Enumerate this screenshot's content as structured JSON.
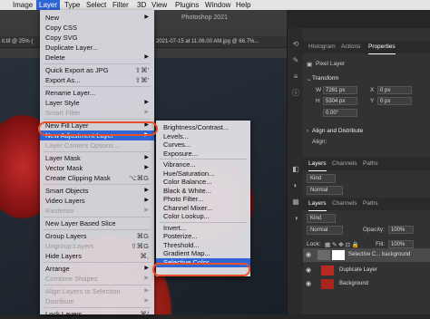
{
  "menubar": {
    "items": [
      "Image",
      "Layer",
      "Type",
      "Select",
      "Filter",
      "3D",
      "View",
      "Plugins",
      "Window",
      "Help"
    ],
    "active": "Layer"
  },
  "app": {
    "title": "Photoshop 2021",
    "doc_tab_left": "it.tif @ 25% (",
    "doc_tab_right": "2021-07-15 at 11.06.00 AM.jpg @ 66.7%..."
  },
  "layer_menu": [
    {
      "label": "New",
      "shortcut": "",
      "arrow": true,
      "disabled": false
    },
    {
      "label": "Copy CSS",
      "shortcut": "",
      "arrow": false,
      "disabled": false
    },
    {
      "label": "Copy SVG",
      "shortcut": "",
      "arrow": false,
      "disabled": false
    },
    {
      "label": "Duplicate Layer...",
      "shortcut": "",
      "arrow": false,
      "disabled": false
    },
    {
      "label": "Delete",
      "shortcut": "",
      "arrow": true,
      "disabled": false
    },
    {
      "sep": true
    },
    {
      "label": "Quick Export as JPG",
      "shortcut": "⇧⌘'",
      "arrow": false,
      "disabled": false
    },
    {
      "label": "Export As...",
      "shortcut": "⇧⌘'",
      "arrow": false,
      "disabled": false
    },
    {
      "sep": true
    },
    {
      "label": "Rename Layer...",
      "shortcut": "",
      "arrow": false,
      "disabled": false
    },
    {
      "label": "Layer Style",
      "shortcut": "",
      "arrow": true,
      "disabled": false
    },
    {
      "label": "Smart Filter",
      "shortcut": "",
      "arrow": true,
      "disabled": true
    },
    {
      "sep": true
    },
    {
      "label": "New Fill Layer",
      "shortcut": "",
      "arrow": true,
      "disabled": false
    },
    {
      "label": "New Adjustment Layer",
      "shortcut": "",
      "arrow": true,
      "disabled": false,
      "highlighted": true
    },
    {
      "label": "Layer Content Options...",
      "shortcut": "",
      "arrow": false,
      "disabled": true
    },
    {
      "sep": true
    },
    {
      "label": "Layer Mask",
      "shortcut": "",
      "arrow": true,
      "disabled": false
    },
    {
      "label": "Vector Mask",
      "shortcut": "",
      "arrow": true,
      "disabled": false
    },
    {
      "label": "Create Clipping Mask",
      "shortcut": "⌥⌘G",
      "arrow": false,
      "disabled": false
    },
    {
      "sep": true
    },
    {
      "label": "Smart Objects",
      "shortcut": "",
      "arrow": true,
      "disabled": false
    },
    {
      "label": "Video Layers",
      "shortcut": "",
      "arrow": true,
      "disabled": false
    },
    {
      "label": "Rasterize",
      "shortcut": "",
      "arrow": true,
      "disabled": true
    },
    {
      "sep": true
    },
    {
      "label": "New Layer Based Slice",
      "shortcut": "",
      "arrow": false,
      "disabled": false
    },
    {
      "sep": true
    },
    {
      "label": "Group Layers",
      "shortcut": "⌘G",
      "arrow": false,
      "disabled": false
    },
    {
      "label": "Ungroup Layers",
      "shortcut": "⇧⌘G",
      "arrow": false,
      "disabled": true
    },
    {
      "label": "Hide Layers",
      "shortcut": "⌘,",
      "arrow": false,
      "disabled": false
    },
    {
      "sep": true
    },
    {
      "label": "Arrange",
      "shortcut": "",
      "arrow": true,
      "disabled": false
    },
    {
      "label": "Combine Shapes",
      "shortcut": "",
      "arrow": true,
      "disabled": true
    },
    {
      "sep": true
    },
    {
      "label": "Align Layers to Selection",
      "shortcut": "",
      "arrow": true,
      "disabled": true
    },
    {
      "label": "Distribute",
      "shortcut": "",
      "arrow": true,
      "disabled": true
    },
    {
      "sep": true
    },
    {
      "label": "Lock Layers...",
      "shortcut": "⌘/",
      "arrow": false,
      "disabled": false
    }
  ],
  "adjustment_submenu": [
    {
      "label": "Brightness/Contrast..."
    },
    {
      "label": "Levels..."
    },
    {
      "label": "Curves..."
    },
    {
      "label": "Exposure..."
    },
    {
      "sep": true
    },
    {
      "label": "Vibrance..."
    },
    {
      "label": "Hue/Saturation..."
    },
    {
      "label": "Color Balance..."
    },
    {
      "label": "Black & White..."
    },
    {
      "label": "Photo Filter..."
    },
    {
      "label": "Channel Mixer..."
    },
    {
      "label": "Color Lookup..."
    },
    {
      "sep": true
    },
    {
      "label": "Invert..."
    },
    {
      "label": "Posterize..."
    },
    {
      "label": "Threshold..."
    },
    {
      "label": "Gradient Map..."
    },
    {
      "label": "Selective Color...",
      "highlighted": true
    }
  ],
  "panel": {
    "top_tabs": [
      "Histogram",
      "Actions",
      "Properties"
    ],
    "active_top_tab": "Properties",
    "pixel_layer": "Pixel Layer",
    "transform": "Transform",
    "w_label": "W",
    "w_value": "7281 px",
    "h_label": "H",
    "h_value": "5304 px",
    "x_label": "X",
    "x_value": "0 px",
    "y_label": "Y",
    "y_value": "0 px",
    "angle_value": "0.00°",
    "align": "Align and Distribute",
    "align_sub": "Align:",
    "layer_tabs_1": [
      "Layers",
      "Channels",
      "Paths"
    ],
    "layer_tabs_2": [
      "Layers",
      "Channels",
      "Paths"
    ],
    "kind": "Kind",
    "blend": "Normal",
    "opacity_label": "Opacity:",
    "opacity": "100%",
    "fill_label": "Fill:",
    "fill": "100%",
    "lock_label": "Lock:",
    "layers": [
      {
        "name": "Selective C... background",
        "selected": true
      },
      {
        "name": "Duplicate Layer",
        "selected": false
      },
      {
        "name": "Background",
        "selected": false
      }
    ]
  },
  "colors": {
    "menu_highlight": "#2f66d6",
    "annotation_ring": "#e8502a"
  }
}
